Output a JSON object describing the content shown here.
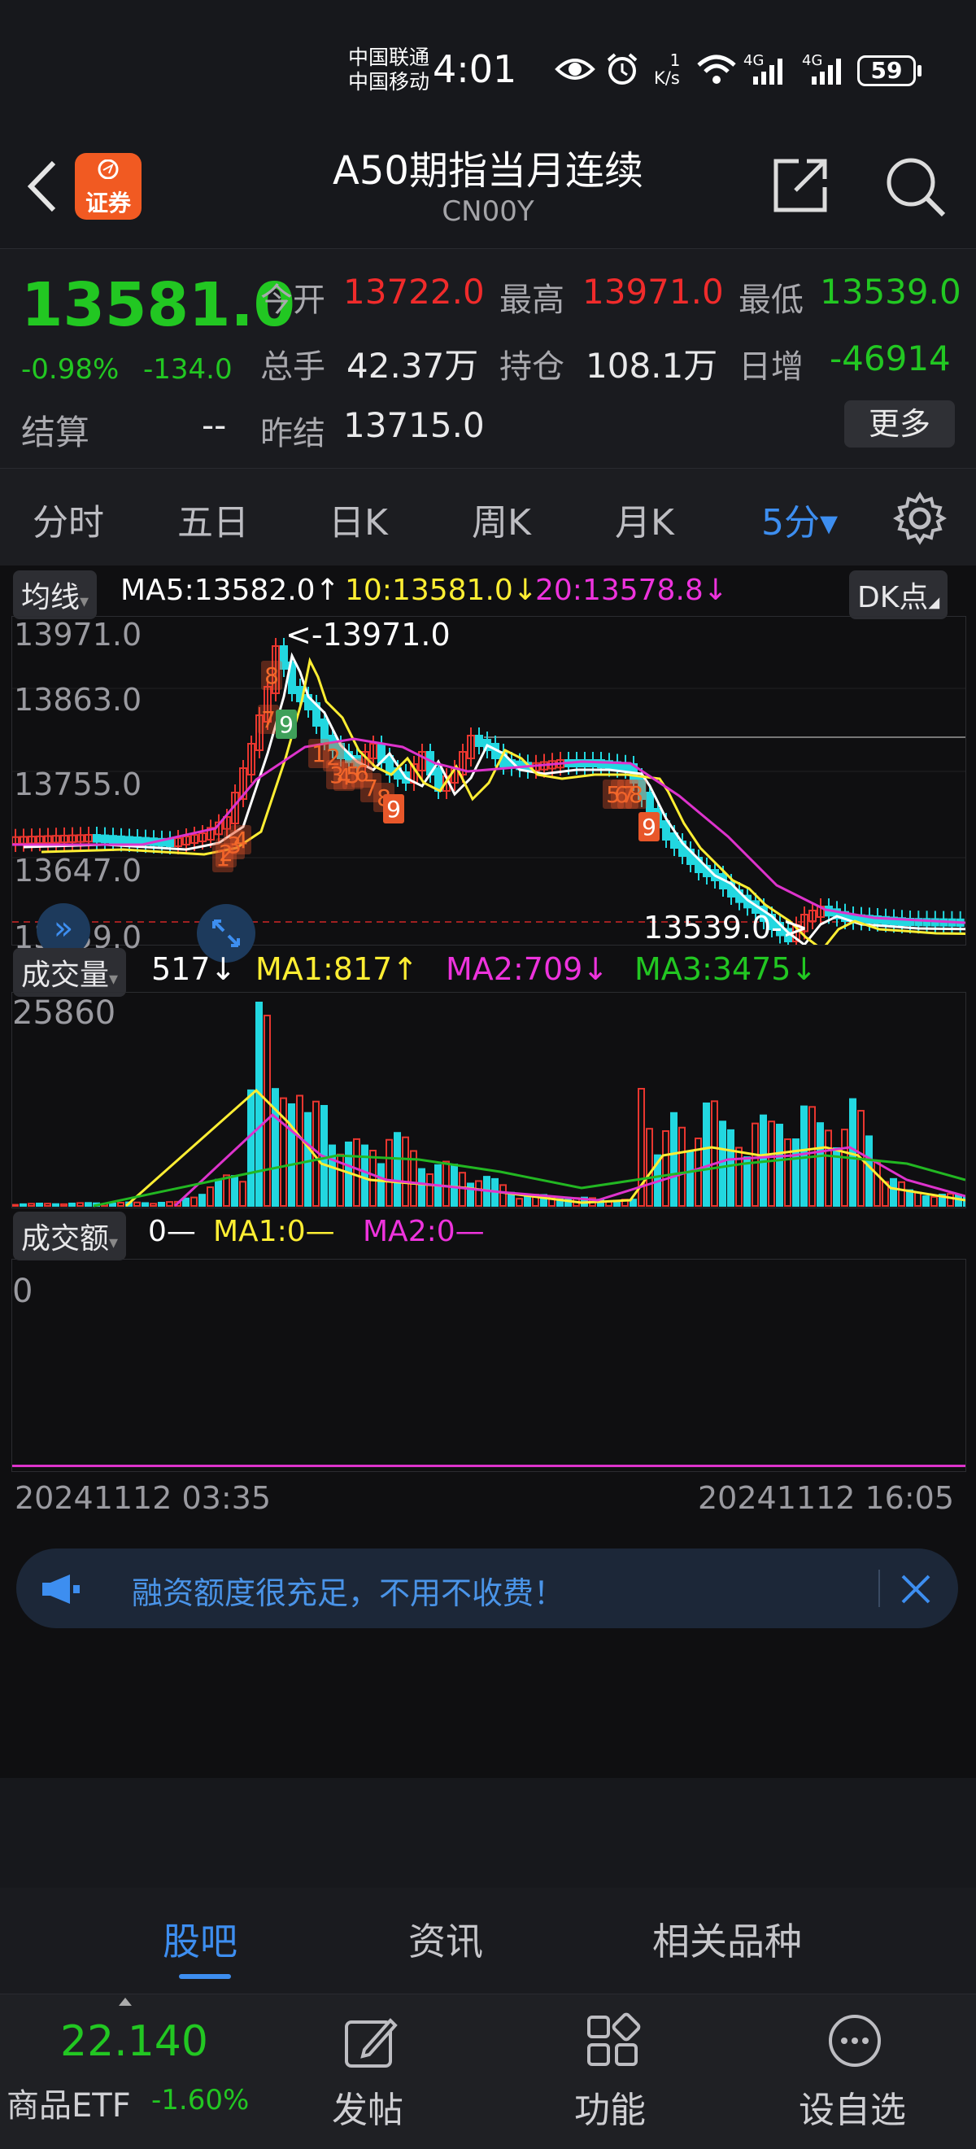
{
  "status_bar": {
    "carrier_1": "中国联通",
    "carrier_2": "中国移动",
    "time": "4:01",
    "net_speed_value": "1",
    "net_speed_unit": "K/s",
    "signal_1": "4G",
    "signal_2": "4G",
    "battery": "59"
  },
  "header": {
    "app_badge": "证券",
    "title": "A50期指当月连续",
    "code": "CN00Y"
  },
  "quote": {
    "price": "13581.0",
    "change_pct": "-0.98%",
    "change": "-134.0",
    "open_label": "今开",
    "open": "13722.0",
    "high_label": "最高",
    "high": "13971.0",
    "low_label": "最低",
    "low": "13539.0",
    "volume_label": "总手",
    "volume": "42.37万",
    "oi_label": "持仓",
    "oi": "108.1万",
    "daily_inc_label": "日增",
    "daily_inc": "-46914",
    "settle_label": "结算",
    "settle": "--",
    "prev_settle_label": "昨结",
    "prev_settle": "13715.0",
    "more_button": "更多"
  },
  "tabs": {
    "items": [
      "分时",
      "五日",
      "日K",
      "周K",
      "月K"
    ],
    "period": "5分▾"
  },
  "kline": {
    "ma_toggle": "均线",
    "ma5": "MA5:13582.0↑",
    "ma10": "10:13581.0↓",
    "ma20": "20:13578.8↓",
    "dk_button": "DK点",
    "y_ticks": [
      "13971.0",
      "13863.0",
      "13755.0",
      "13647.0",
      "13539.0"
    ],
    "high_marker": "<-13971.0",
    "low_marker": "13539.0->",
    "td_labels": [
      "8",
      "7",
      "9",
      "1",
      "2",
      "3",
      "4",
      "5",
      "6",
      "7",
      "8",
      "9",
      "1",
      "2",
      "3",
      "4",
      "5",
      "6",
      "7",
      "8",
      "9"
    ],
    "colors": {
      "up": "#e8362f",
      "down": "#22d7e0",
      "ma5": "#ffffff",
      "ma10": "#ffee33",
      "ma20": "#dd33cc"
    }
  },
  "volume": {
    "toggle": "成交量",
    "value": "517↓",
    "ma1": "MA1:817↑",
    "ma2": "MA2:709↓",
    "ma3": "MA3:3475↓",
    "y_top": "25860"
  },
  "turnover": {
    "toggle": "成交额",
    "value": "0—",
    "ma1": "MA1:0—",
    "ma2": "MA2:0—",
    "y_top": "0"
  },
  "time_axis": {
    "start": "20241112 03:35",
    "end": "20241112 16:05"
  },
  "banner": {
    "text": "融资额度很充足，不用不收费！"
  },
  "community_tabs": [
    "股吧",
    "资讯",
    "相关品种"
  ],
  "bottom_nav": {
    "etf_price": "22.140",
    "etf_name": "商品ETF",
    "etf_change": "-1.60%",
    "post": "发帖",
    "func": "功能",
    "watch": "设自选"
  }
}
